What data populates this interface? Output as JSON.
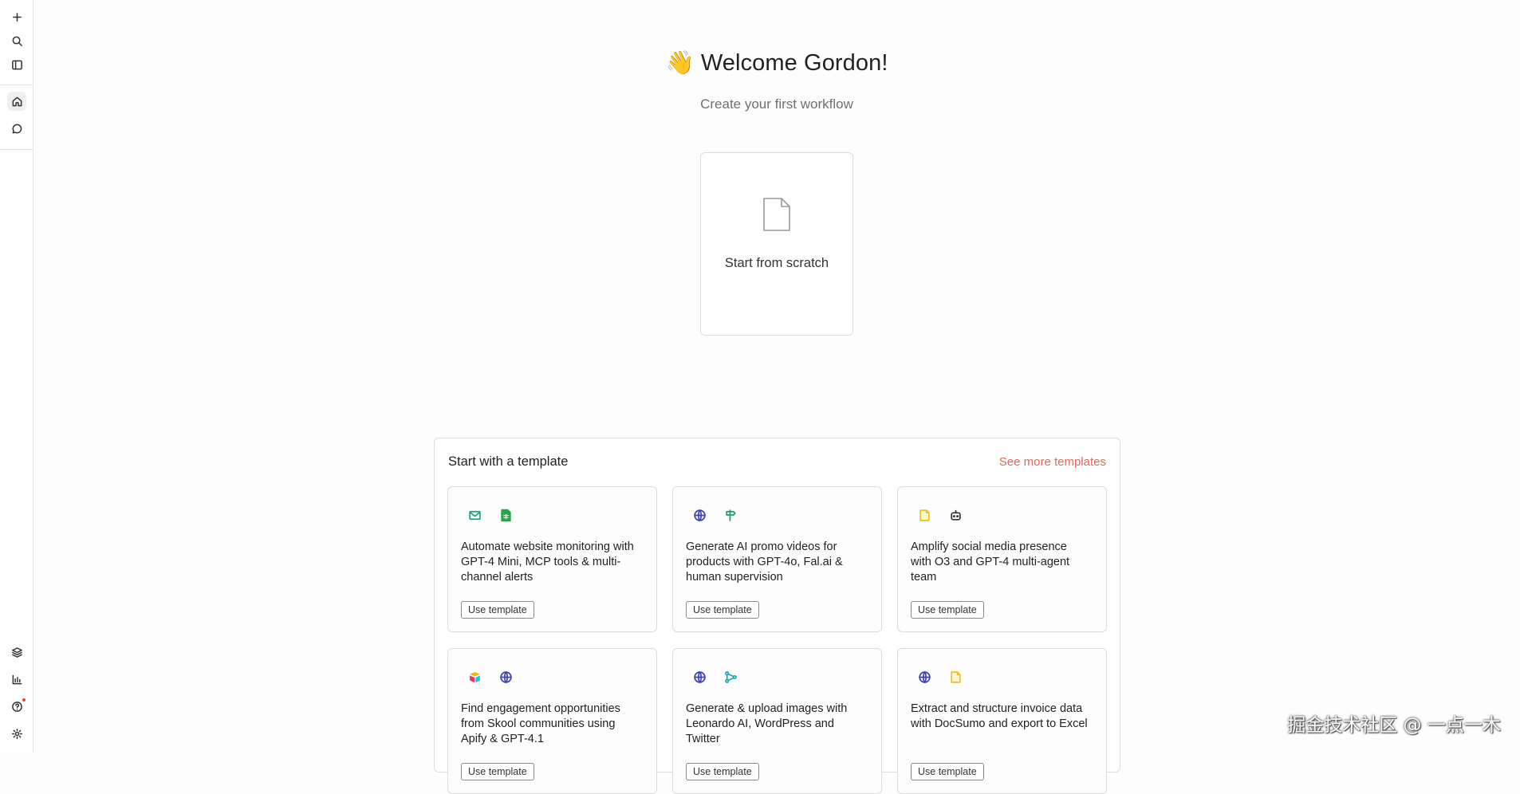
{
  "sidebar": {
    "top": [
      {
        "name": "new-icon"
      },
      {
        "name": "search-icon"
      },
      {
        "name": "panel-toggle-icon"
      }
    ],
    "nav": [
      {
        "name": "home-icon",
        "active": true
      },
      {
        "name": "chat-icon",
        "active": false
      }
    ],
    "bottom": [
      {
        "name": "layers-icon"
      },
      {
        "name": "chart-icon"
      },
      {
        "name": "help-icon",
        "notification": true
      },
      {
        "name": "settings-icon"
      }
    ]
  },
  "welcome": {
    "emoji": "👋",
    "title": "Welcome Gordon!",
    "subtitle": "Create your first workflow"
  },
  "scratch": {
    "label": "Start from scratch",
    "icon": "document-icon"
  },
  "templates": {
    "heading": "Start with a template",
    "more_link": "See more templates",
    "use_label": "Use template",
    "items": [
      {
        "icons": [
          "mail-icon",
          "sheet-icon"
        ],
        "title": "Automate website monitoring with GPT-4 Mini, MCP tools & multi-channel alerts"
      },
      {
        "icons": [
          "globe-icon",
          "signpost-icon"
        ],
        "title": "Generate AI promo videos for products with GPT-4o, Fal.ai & human supervision"
      },
      {
        "icons": [
          "note-icon",
          "robot-icon"
        ],
        "title": "Amplify social media presence with O3 and GPT-4 multi-agent team"
      },
      {
        "icons": [
          "airtable-icon",
          "globe-icon"
        ],
        "title": "Find engagement opportunities from Skool communities using Apify & GPT-4.1"
      },
      {
        "icons": [
          "globe-icon",
          "flow-icon"
        ],
        "title": "Generate & upload images with Leonardo AI, WordPress and Twitter"
      },
      {
        "icons": [
          "globe-icon",
          "note-icon"
        ],
        "title": "Extract and structure invoice data with DocSumo and export to Excel"
      }
    ]
  },
  "colors": {
    "link": "#e0685a",
    "mail": "#17a589",
    "sheet": "#22a845",
    "globe": "#3b3fb0",
    "signpost": "#17a06a",
    "note": "#e8c22a",
    "flow": "#20a0a8"
  },
  "watermark": "掘金技术社区 @ 一点一木"
}
